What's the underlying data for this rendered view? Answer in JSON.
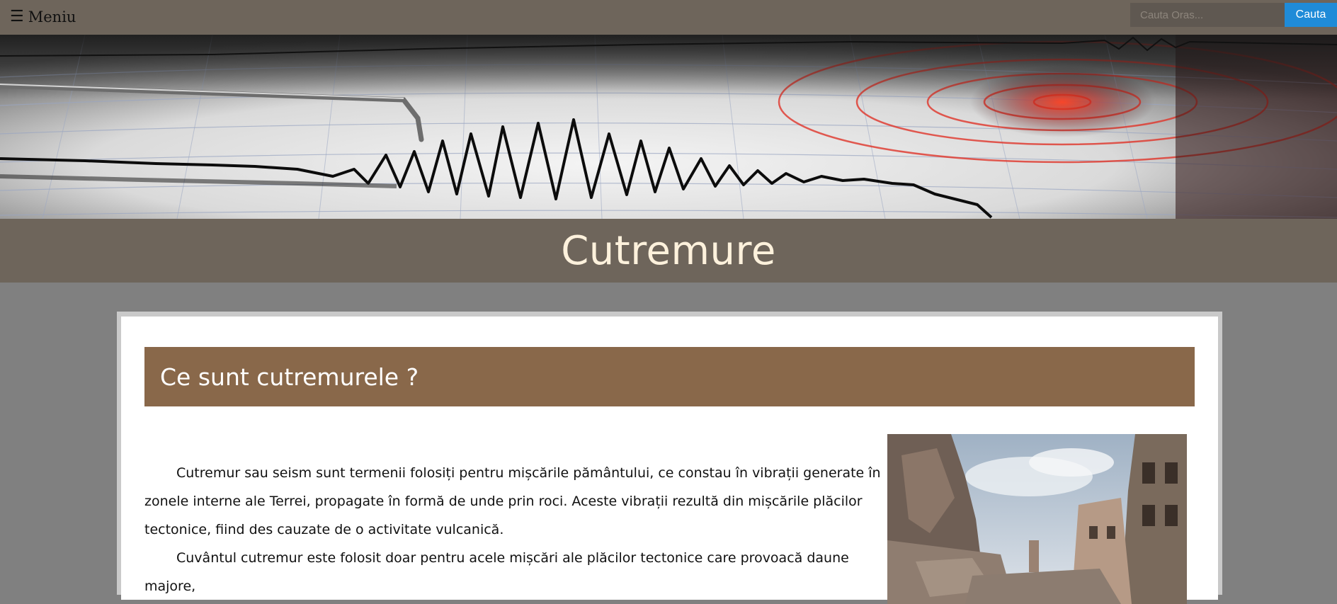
{
  "nav": {
    "menu_icon": "☰",
    "menu_label": "Meniu",
    "search_placeholder": "Cauta Oras...",
    "search_button": "Cauta"
  },
  "hero": {
    "image": "seismograph-banner"
  },
  "page": {
    "title": "Cutremure"
  },
  "section": {
    "heading": "Ce sunt cutremurele ?",
    "paragraphs": [
      "Cutremur sau seism sunt termenii folosiți pentru mișcările pământului, ce constau în vibrații generate în zonele interne ale Terrei, propagate în formă de unde prin roci. Aceste vibrații rezultă din mișcările plăcilor tectonice, fiind des cauzate de o activitate vulcanică.",
      "Cuvântul cutremur este folosit doar pentru acele mișcări ale plăcilor tectonice care provoacă daune majore,"
    ],
    "photo": "earthquake-ruins-street"
  },
  "colors": {
    "topbar": "#6e655b",
    "page_bg": "#808080",
    "section_head": "#89684a",
    "title_text": "#fdf1dc",
    "button": "#1f8bd8"
  }
}
